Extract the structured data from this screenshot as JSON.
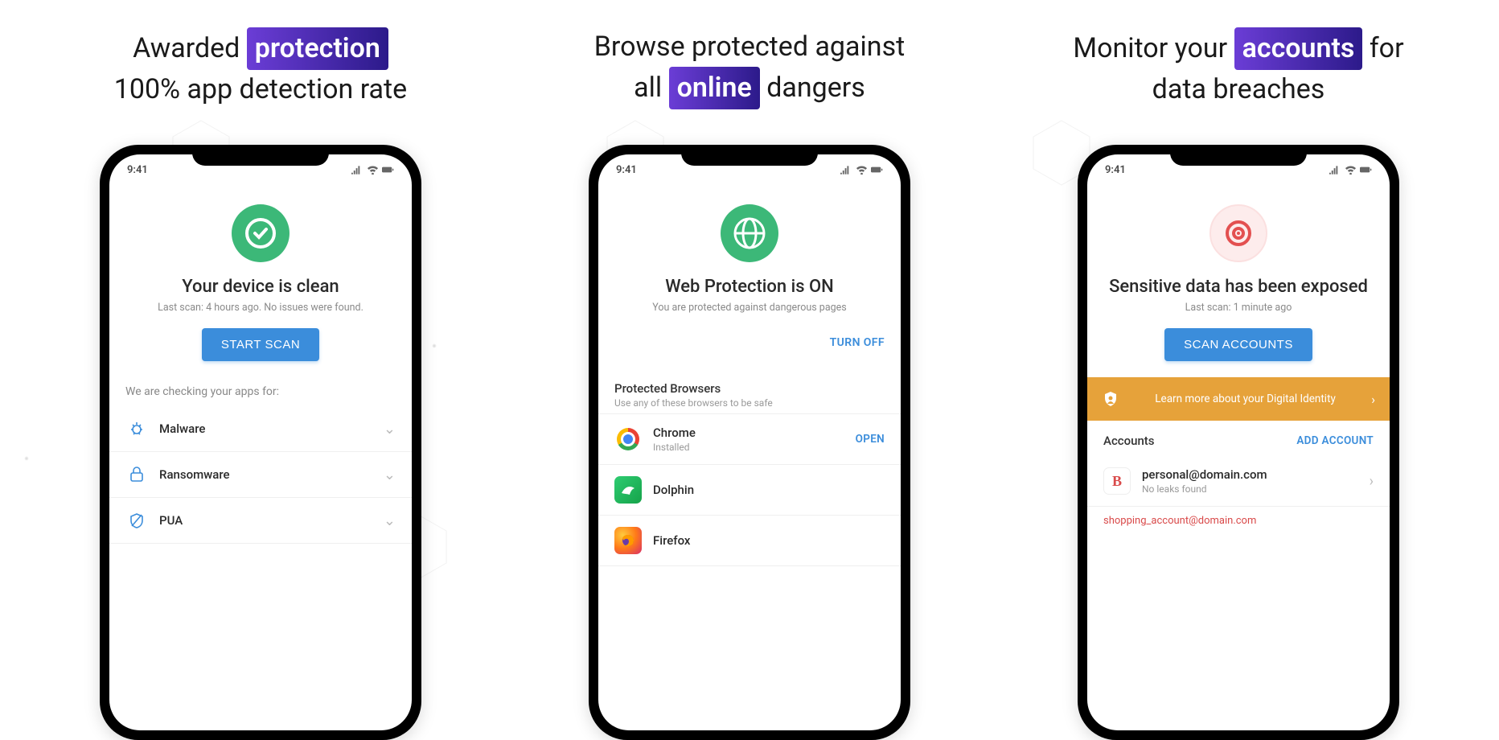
{
  "statusbar_time": "9:41",
  "panel1": {
    "headline_pre": "Awarded ",
    "headline_highlight": "protection",
    "headline_line2": "100% app detection rate",
    "hero_title": "Your device is clean",
    "hero_sub": "Last scan: 4 hours ago. No issues were found.",
    "cta": "START SCAN",
    "check_label": "We are checking your apps for:",
    "items": [
      {
        "label": "Malware"
      },
      {
        "label": "Ransomware"
      },
      {
        "label": "PUA"
      }
    ]
  },
  "panel2": {
    "headline_pre": "Browse protected against",
    "headline_pre2": "all ",
    "headline_highlight": "online",
    "headline_post2": " dangers",
    "hero_title": "Web Protection is ON",
    "hero_sub": "You are protected against dangerous pages",
    "turnoff": "TURN OFF",
    "section_title": "Protected Browsers",
    "section_sub": "Use any of these browsers to be safe",
    "browsers": [
      {
        "name": "Chrome",
        "sub": "Installed",
        "action": "OPEN"
      },
      {
        "name": "Dolphin"
      },
      {
        "name": "Firefox"
      }
    ]
  },
  "panel3": {
    "headline_pre": "Monitor your ",
    "headline_highlight": "accounts",
    "headline_post": " for",
    "headline_line2": "data breaches",
    "hero_title": "Sensitive data has been exposed",
    "hero_sub": "Last scan: 1 minute ago",
    "cta": "SCAN ACCOUNTS",
    "banner": "Learn more about your Digital Identity",
    "accounts_title": "Accounts",
    "add_account": "ADD ACCOUNT",
    "accounts": [
      {
        "email": "personal@domain.com",
        "sub": "No leaks found",
        "letter": "B",
        "color": "#d94a4a"
      }
    ],
    "leaked_hint": "shopping_account@domain.com"
  }
}
